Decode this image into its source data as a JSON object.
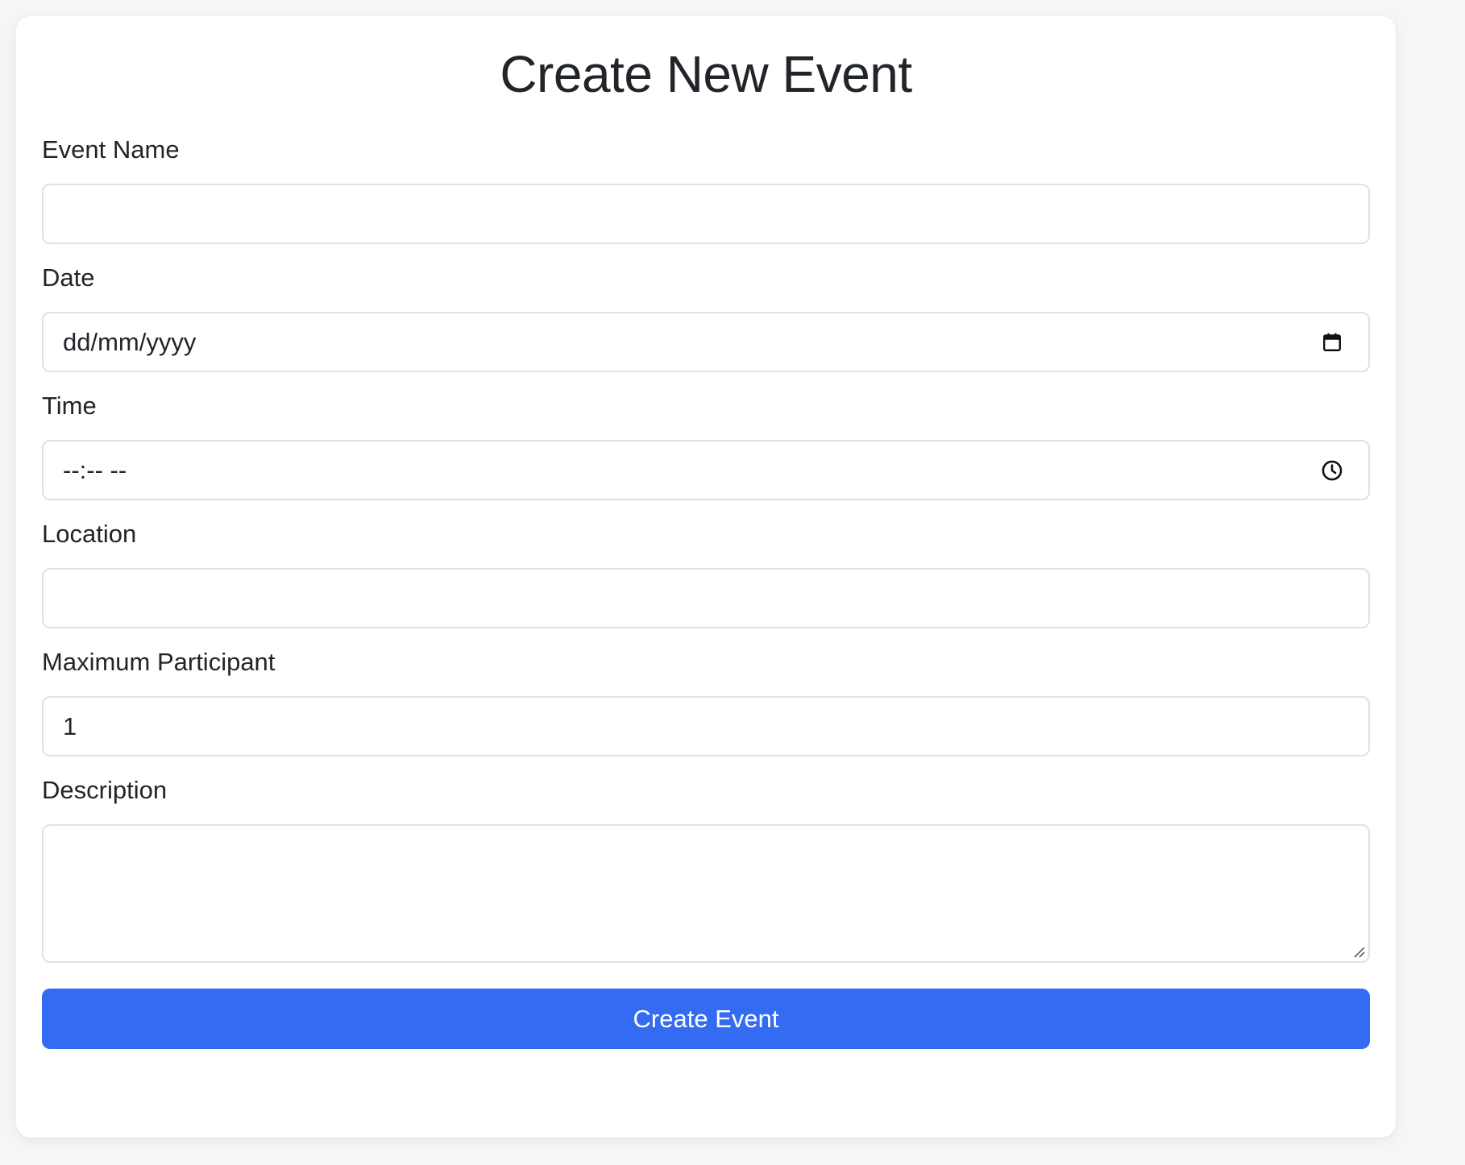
{
  "form": {
    "title": "Create New Event",
    "fields": {
      "event_name": {
        "label": "Event Name",
        "value": "",
        "placeholder": ""
      },
      "date": {
        "label": "Date",
        "value": "dd/mm/yyyy",
        "icon": "calendar-icon"
      },
      "time": {
        "label": "Time",
        "value": "--:-- --",
        "icon": "clock-icon"
      },
      "location": {
        "label": "Location",
        "value": "",
        "placeholder": ""
      },
      "max_participant": {
        "label": "Maximum Participant",
        "value": "1"
      },
      "description": {
        "label": "Description",
        "value": ""
      }
    },
    "submit_label": "Create Event"
  },
  "colors": {
    "background": "#f5f6f8",
    "card": "#ffffff",
    "border": "#dee2e6",
    "text": "#212529",
    "primary": "#336cf2"
  }
}
